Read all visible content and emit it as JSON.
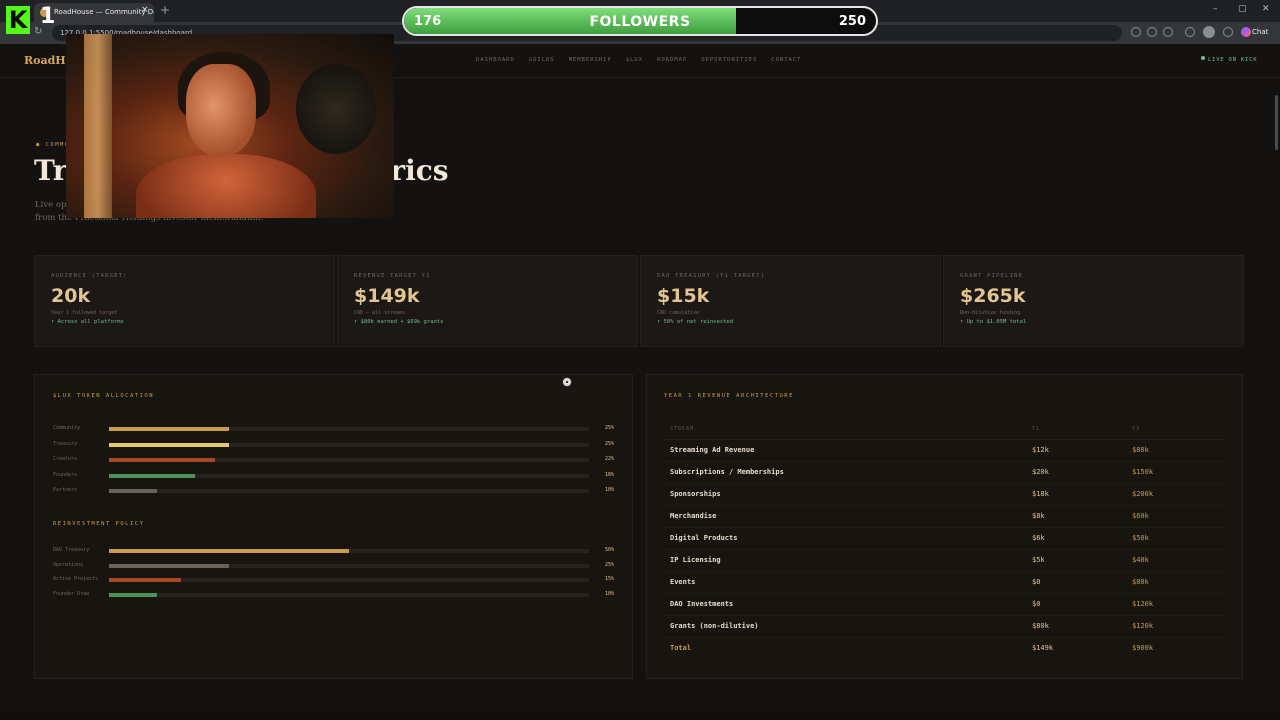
{
  "browser": {
    "tab_title": "RoadHouse — Community Dashb...",
    "tab_close": "×",
    "new_tab": "+",
    "url": "127.0.0.1:5500/roadhouse/dashboard",
    "back": "←",
    "forward": "→",
    "reload": "↻",
    "minimize": "–",
    "maximize": "▢",
    "close": "✕",
    "chat_label": "Chat"
  },
  "overlay": {
    "kick_logo": "K",
    "kick_count": "1",
    "followers_current": "176",
    "followers_label": "FOLLOWERS",
    "followers_goal": "250",
    "followers_progress": 0.704
  },
  "site": {
    "brand": "RoadHo",
    "nav": [
      "DASHBOARD",
      "GUILDS",
      "MEMBERSHIP",
      "$LUX",
      "ROADMAP",
      "OPPORTUNITIES",
      "CONTACT"
    ],
    "live_label": "LIVE ON KICK"
  },
  "hero": {
    "eyebrow": "● COMMU",
    "title_start": "Tr",
    "title_end": "etrics",
    "subtitle_line1": "Live op",
    "subtitle_line2": "from the Fractional Holdings investor memorandum."
  },
  "stats": [
    {
      "label": "AUDIENCE (TARGET)",
      "value": "20k",
      "note": "Year 1 followed target",
      "delta": "↑ Across all platforms"
    },
    {
      "label": "REVENUE TARGET Y1",
      "value": "$149k",
      "note": "CAD — all streams",
      "delta": "↑ $80k earned + $69k grants"
    },
    {
      "label": "DAO TREASURY (Y1 TARGET)",
      "value": "$15k",
      "note": "CAD cumulative",
      "delta": "↑ 50% of net reinvested"
    },
    {
      "label": "GRANT PIPELINE",
      "value": "$265k",
      "note": "Non-dilutive funding",
      "delta": "↑ Up to $1.05M total"
    }
  ],
  "allocation": {
    "title": "$LUX TOKEN ALLOCATION",
    "items": [
      {
        "label": "Community",
        "value": 25,
        "pct": "25%",
        "color": "#c99a50"
      },
      {
        "label": "Treasury",
        "value": 25,
        "pct": "25%",
        "color": "#e6c76a"
      },
      {
        "label": "Creators",
        "value": 22,
        "pct": "22%",
        "color": "#a8482a"
      },
      {
        "label": "Founders",
        "value": 18,
        "pct": "18%",
        "color": "#4f8f5a"
      },
      {
        "label": "Partners",
        "value": 10,
        "pct": "10%",
        "color": "#6a6258"
      }
    ]
  },
  "reinvestment": {
    "title": "REINVESTMENT POLICY",
    "items": [
      {
        "label": "DAO Treasury",
        "value": 50,
        "pct": "50%",
        "color": "#c99a50"
      },
      {
        "label": "Operations",
        "value": 25,
        "pct": "25%",
        "color": "#6a6258"
      },
      {
        "label": "Active Projects",
        "value": 15,
        "pct": "15%",
        "color": "#a8482a"
      },
      {
        "label": "Founder Draw",
        "value": 10,
        "pct": "10%",
        "color": "#4f8f5a"
      }
    ]
  },
  "revenue": {
    "title": "YEAR 1 REVENUE ARCHITECTURE",
    "headers": [
      "STREAM",
      "Y1",
      "Y3"
    ],
    "rows": [
      {
        "stream": "Streaming Ad Revenue",
        "y1": "$12k",
        "y3": "$80k"
      },
      {
        "stream": "Subscriptions / Memberships",
        "y1": "$20k",
        "y3": "$150k"
      },
      {
        "stream": "Sponsorships",
        "y1": "$18k",
        "y3": "$200k"
      },
      {
        "stream": "Merchandise",
        "y1": "$8k",
        "y3": "$60k"
      },
      {
        "stream": "Digital Products",
        "y1": "$6k",
        "y3": "$50k"
      },
      {
        "stream": "IP Licensing",
        "y1": "$5k",
        "y3": "$40k"
      },
      {
        "stream": "Events",
        "y1": "$0",
        "y3": "$80k"
      },
      {
        "stream": "DAO Investments",
        "y1": "$0",
        "y3": "$120k"
      },
      {
        "stream": "Grants (non-dilutive)",
        "y1": "$80k",
        "y3": "$120k"
      },
      {
        "stream": "Total",
        "y1": "$149k",
        "y3": "$900k"
      }
    ]
  }
}
